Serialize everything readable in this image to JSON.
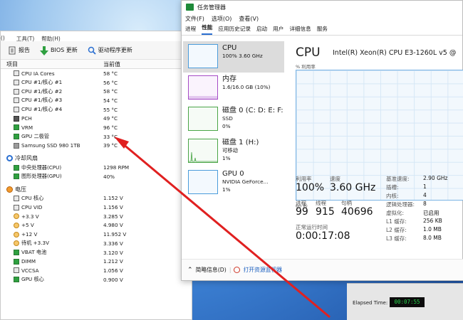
{
  "back_window": {
    "menu": [
      "()",
      "工具(T)",
      "帮助(H)"
    ],
    "toolbar": {
      "report": "报告",
      "bios": "BIOS 更新",
      "driver": "驱动程序更新"
    },
    "headers": {
      "item": "项目",
      "value": "当前值"
    },
    "temps": [
      {
        "name": "CPU IA Cores",
        "value": "58 °C",
        "icon": "cpu-chip-icon"
      },
      {
        "name": "CPU #1/核心 #1",
        "value": "56 °C",
        "icon": "cpu-chip-icon"
      },
      {
        "name": "CPU #1/核心 #2",
        "value": "58 °C",
        "icon": "cpu-chip-icon"
      },
      {
        "name": "CPU #1/核心 #3",
        "value": "54 °C",
        "icon": "cpu-chip-icon"
      },
      {
        "name": "CPU #1/核心 #4",
        "value": "55 °C",
        "icon": "cpu-chip-icon"
      },
      {
        "name": "PCH",
        "value": "49 °C",
        "icon": "chipset-icon"
      },
      {
        "name": "VRM",
        "value": "96 °C",
        "icon": "vrm-icon"
      },
      {
        "name": "GPU 二极管",
        "value": "33 °C",
        "icon": "gpu-icon"
      },
      {
        "name": "Samsung SSD 980 1TB",
        "value": "39 °C",
        "icon": "ssd-icon"
      }
    ],
    "fans_title": "冷却风扇",
    "fans": [
      {
        "name": "中央处理器(CPU)",
        "value": "1298 RPM"
      },
      {
        "name": "图形处理器(GPU)",
        "value": "40%"
      }
    ],
    "voltage_title": "电压",
    "voltages": [
      {
        "name": "CPU 核心",
        "value": "1.152 V",
        "icon": "cpu-chip-icon"
      },
      {
        "name": "CPU VID",
        "value": "1.156 V",
        "icon": "cpu-chip-icon"
      },
      {
        "name": "+3.3 V",
        "value": "3.285 V",
        "icon": "rail-icon"
      },
      {
        "name": "+5 V",
        "value": "4.980 V",
        "icon": "rail-icon"
      },
      {
        "name": "+12 V",
        "value": "11.952 V",
        "icon": "rail-icon"
      },
      {
        "name": "待机 +3.3V",
        "value": "3.336 V",
        "icon": "rail-icon"
      },
      {
        "name": "VBAT 电池",
        "value": "3.120 V",
        "icon": "battery-icon"
      },
      {
        "name": "DIMM",
        "value": "1.212 V",
        "icon": "memory-icon"
      },
      {
        "name": "VCCSA",
        "value": "1.056 V",
        "icon": "cpu-chip-icon"
      },
      {
        "name": "GPU 核心",
        "value": "0.900 V",
        "icon": "gpu-icon"
      }
    ]
  },
  "task_manager": {
    "title": "任务管理器",
    "menu": [
      "文件(F)",
      "选项(O)",
      "查看(V)"
    ],
    "tabs": [
      "进程",
      "性能",
      "应用历史记录",
      "启动",
      "用户",
      "详细信息",
      "服务"
    ],
    "active_tab": "性能",
    "sidebar": [
      {
        "title": "CPU",
        "line1": "100% 3.60 GHz",
        "line2": "",
        "selected": true,
        "color": "#4b9cdb"
      },
      {
        "title": "内存",
        "line1": "1.6/16.0 GB (10%)",
        "line2": "",
        "selected": false,
        "color": "#a64cc6"
      },
      {
        "title": "磁盘 0 (C: D: E: F:",
        "line1": "SSD",
        "line2": "0%",
        "selected": false,
        "color": "#4aa547"
      },
      {
        "title": "磁盘 1 (H:)",
        "line1": "可移动",
        "line2": "1%",
        "selected": false,
        "color": "#4aa547"
      },
      {
        "title": "GPU 0",
        "line1": "NVIDIA GeForce...",
        "line2": "1%",
        "selected": false,
        "color": "#4b9cdb"
      }
    ],
    "main": {
      "title": "CPU",
      "model": "Intel(R) Xeon(R) CPU E3-1260L v5 @",
      "util_label": "% 利用率",
      "axis_left": "60 秒",
      "utilization_label": "利用率",
      "utilization": "100%",
      "speed_label": "速度",
      "speed": "3.60 GHz",
      "processes_label": "进程",
      "processes": "99",
      "threads_label": "线程",
      "threads": "915",
      "handles_label": "句柄",
      "handles": "40696",
      "uptime_label": "正常运行时间",
      "uptime": "0:00:17:08",
      "details": [
        {
          "k": "基准速度:",
          "v": "2.90 GHz"
        },
        {
          "k": "插槽:",
          "v": "1"
        },
        {
          "k": "内核:",
          "v": "4"
        },
        {
          "k": "逻辑处理器:",
          "v": "8"
        },
        {
          "k": "虚拟化:",
          "v": "已启用"
        },
        {
          "k": "L1 缓存:",
          "v": "256 KB"
        },
        {
          "k": "L2 缓存:",
          "v": "1.0 MB"
        },
        {
          "k": "L3 缓存:",
          "v": "8.0 MB"
        }
      ]
    },
    "footer": {
      "less": "简略信息(D)",
      "monitor": "打开资源监视器"
    }
  },
  "elapsed": {
    "label": "Elapsed Time:",
    "value": "00:07:55"
  },
  "colors": {
    "annotation_arrow": "#e02020",
    "timer_text": "#26d34a"
  }
}
